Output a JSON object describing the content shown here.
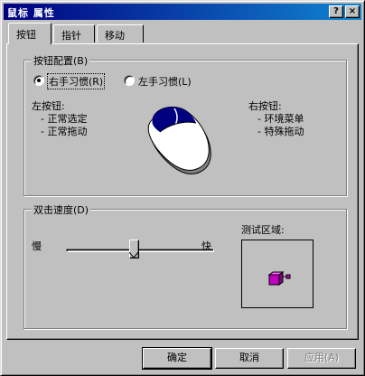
{
  "window": {
    "title": "鼠标 属性",
    "help_label": "?",
    "close_label": "×"
  },
  "tabs": [
    {
      "label": "按钮",
      "active": true
    },
    {
      "label": "指针",
      "active": false
    },
    {
      "label": "移动",
      "active": false
    }
  ],
  "button_config": {
    "group_title": "按钮配置(B)",
    "options": [
      {
        "label": "右手习惯(R)",
        "selected": true
      },
      {
        "label": "左手习惯(L)",
        "selected": false
      }
    ],
    "left_button_title": "左按钮:",
    "left_button_items": [
      "- 正常选定",
      "- 正常拖动"
    ],
    "right_button_title": "右按钮:",
    "right_button_items": [
      "- 环境菜单",
      "- 特殊拖动"
    ]
  },
  "double_click": {
    "group_title": "双击速度(D)",
    "slow_label": "慢",
    "fast_label": "快",
    "speed_value": 0.46,
    "test_area_label": "测试区域:"
  },
  "footer": {
    "ok_label": "确定",
    "cancel_label": "取消",
    "apply_label": "应用(A)"
  },
  "colors": {
    "title_bar": "#000080",
    "face": "#c0c0c0",
    "jack_in_the_box": "#c000c0"
  }
}
